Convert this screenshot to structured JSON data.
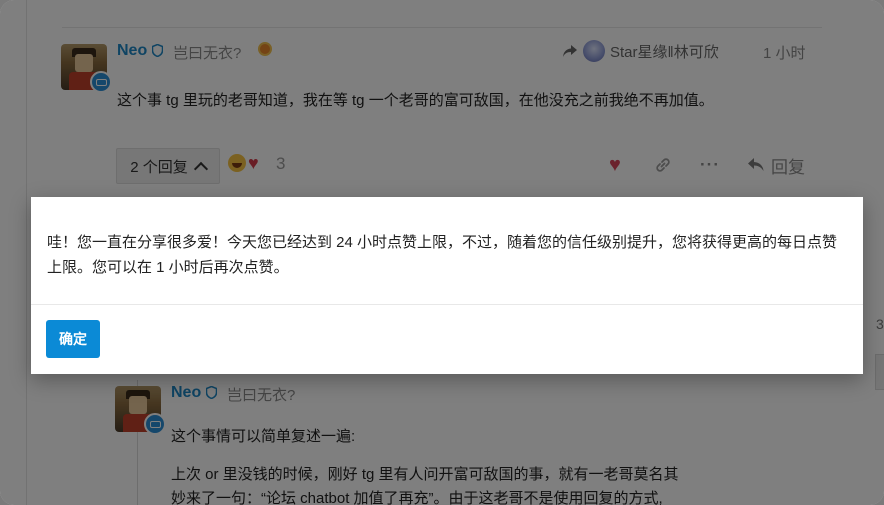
{
  "post1": {
    "username": "Neo",
    "user_title": "岂曰无衣?",
    "reply_to_user": "Star星缘‖林可欣",
    "time_ago": "1 小时",
    "body": "这个事 tg 里玩的老哥知道，我在等 tg 一个老哥的富可敌国，在他没充之前我绝不再加值。",
    "replies_label": "2 个回复",
    "reaction_count": "3",
    "reply_label": "回复"
  },
  "post2": {
    "username": "Neo",
    "user_title": "岂曰无衣?",
    "line1": "这个事情可以简单复述一遍:",
    "line2": "上次 or 里没钱的时候，刚好 tg 里有人问开富可敌国的事，就有一老哥莫名其",
    "line3": "妙来了一句：“论坛 chatbot 加值了再充”。由于这老哥不是使用回复的方式,"
  },
  "side_fragment": "3",
  "modal": {
    "message": "哇！您一直在分享很多爱！今天您已经达到 24 小时点赞上限，不过，随着您的信任级别提升，您将获得更高的每日点赞上限。您可以在 1 小时后再次点赞。",
    "ok_label": "确定"
  },
  "icons": {
    "shield": "shield-icon",
    "reply_arrow": "reply-arrow-icon",
    "heart": "heart-icon",
    "link": "link-icon",
    "more": "more-icon",
    "reply": "reply-icon"
  },
  "colors": {
    "accent": "#0b8ad6",
    "username": "#1e88c7",
    "heart": "#d6455a"
  }
}
